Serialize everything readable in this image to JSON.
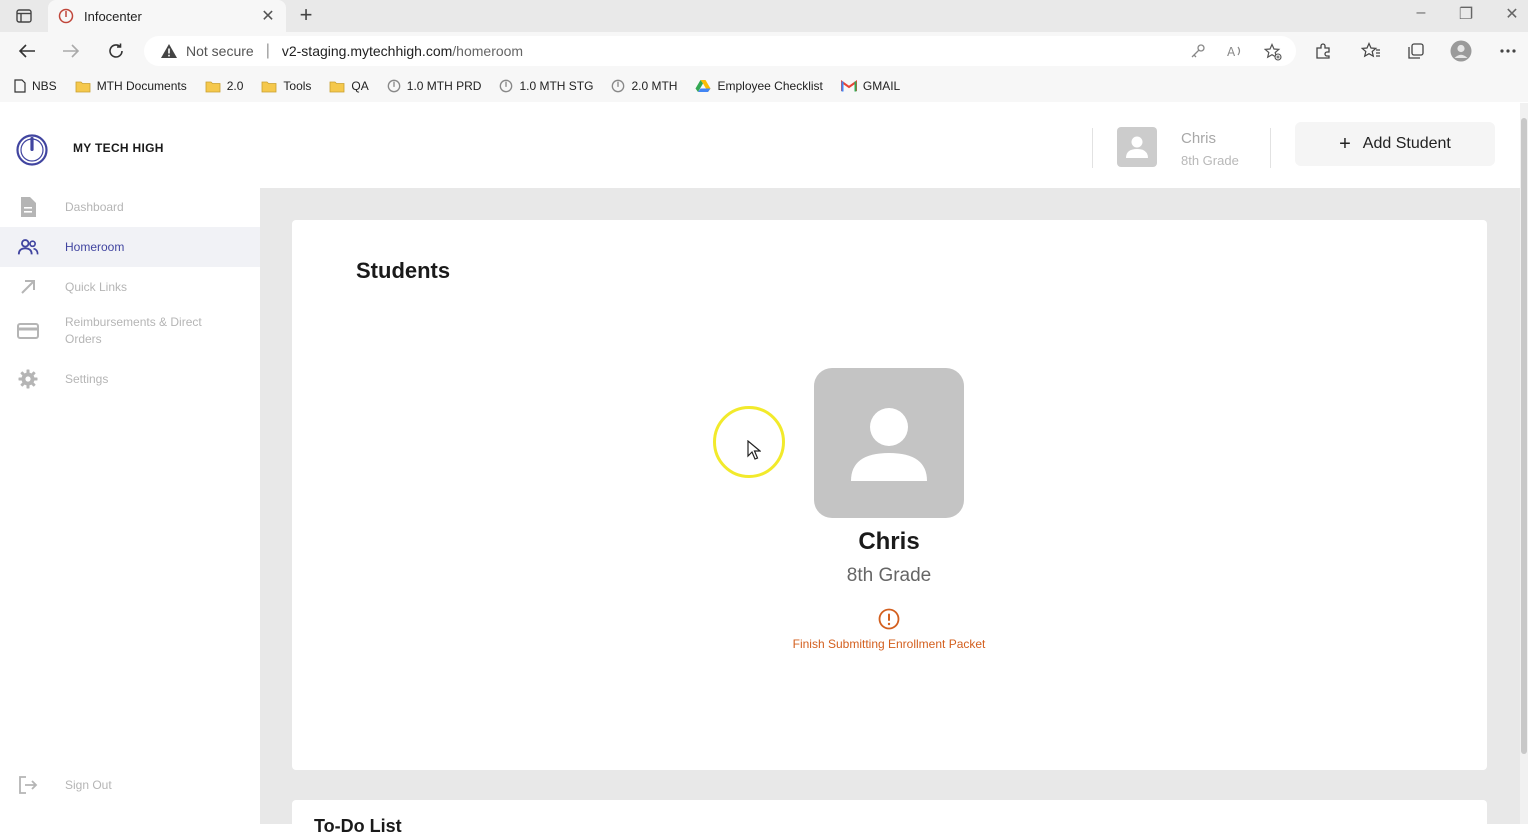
{
  "browser": {
    "tab_title": "Infocenter",
    "address_warning": "Not secure",
    "url_host": "v2-staging.mytechhigh.com",
    "url_path": "/homeroom",
    "bookmarks": [
      {
        "label": "NBS",
        "icon": "page-icon"
      },
      {
        "label": "MTH Documents",
        "icon": "folder-icon"
      },
      {
        "label": "2.0",
        "icon": "folder-icon"
      },
      {
        "label": "Tools",
        "icon": "folder-icon"
      },
      {
        "label": "QA",
        "icon": "folder-icon"
      },
      {
        "label": "1.0 MTH PRD",
        "icon": "mth-logo-icon"
      },
      {
        "label": "1.0 MTH STG",
        "icon": "mth-logo-icon"
      },
      {
        "label": "2.0 MTH",
        "icon": "mth-logo-icon"
      },
      {
        "label": "Employee Checklist",
        "icon": "drive-icon"
      },
      {
        "label": "GMAIL",
        "icon": "gmail-icon"
      }
    ]
  },
  "app": {
    "brand": "MY TECH HIGH",
    "nav": [
      {
        "label": "Dashboard",
        "icon": "document-icon",
        "active": false
      },
      {
        "label": "Homeroom",
        "icon": "people-icon",
        "active": true
      },
      {
        "label": "Quick Links",
        "icon": "arrow-up-right-icon",
        "active": false
      },
      {
        "label": "Reimbursements & Direct Orders",
        "icon": "credit-card-icon",
        "active": false
      },
      {
        "label": "Settings",
        "icon": "gear-icon",
        "active": false
      }
    ],
    "sign_out": "Sign Out",
    "header": {
      "student_name": "Chris",
      "student_grade": "8th Grade",
      "add_student_label": "Add Student"
    },
    "students_card": {
      "title": "Students",
      "student": {
        "name": "Chris",
        "grade": "8th Grade",
        "status": "Finish Submitting Enrollment Packet"
      }
    },
    "todo_card": {
      "title": "To-Do List"
    },
    "colors": {
      "accent": "#4145a0",
      "warning": "#d35f1e",
      "avatar_bg": "#c4c4c4"
    }
  }
}
